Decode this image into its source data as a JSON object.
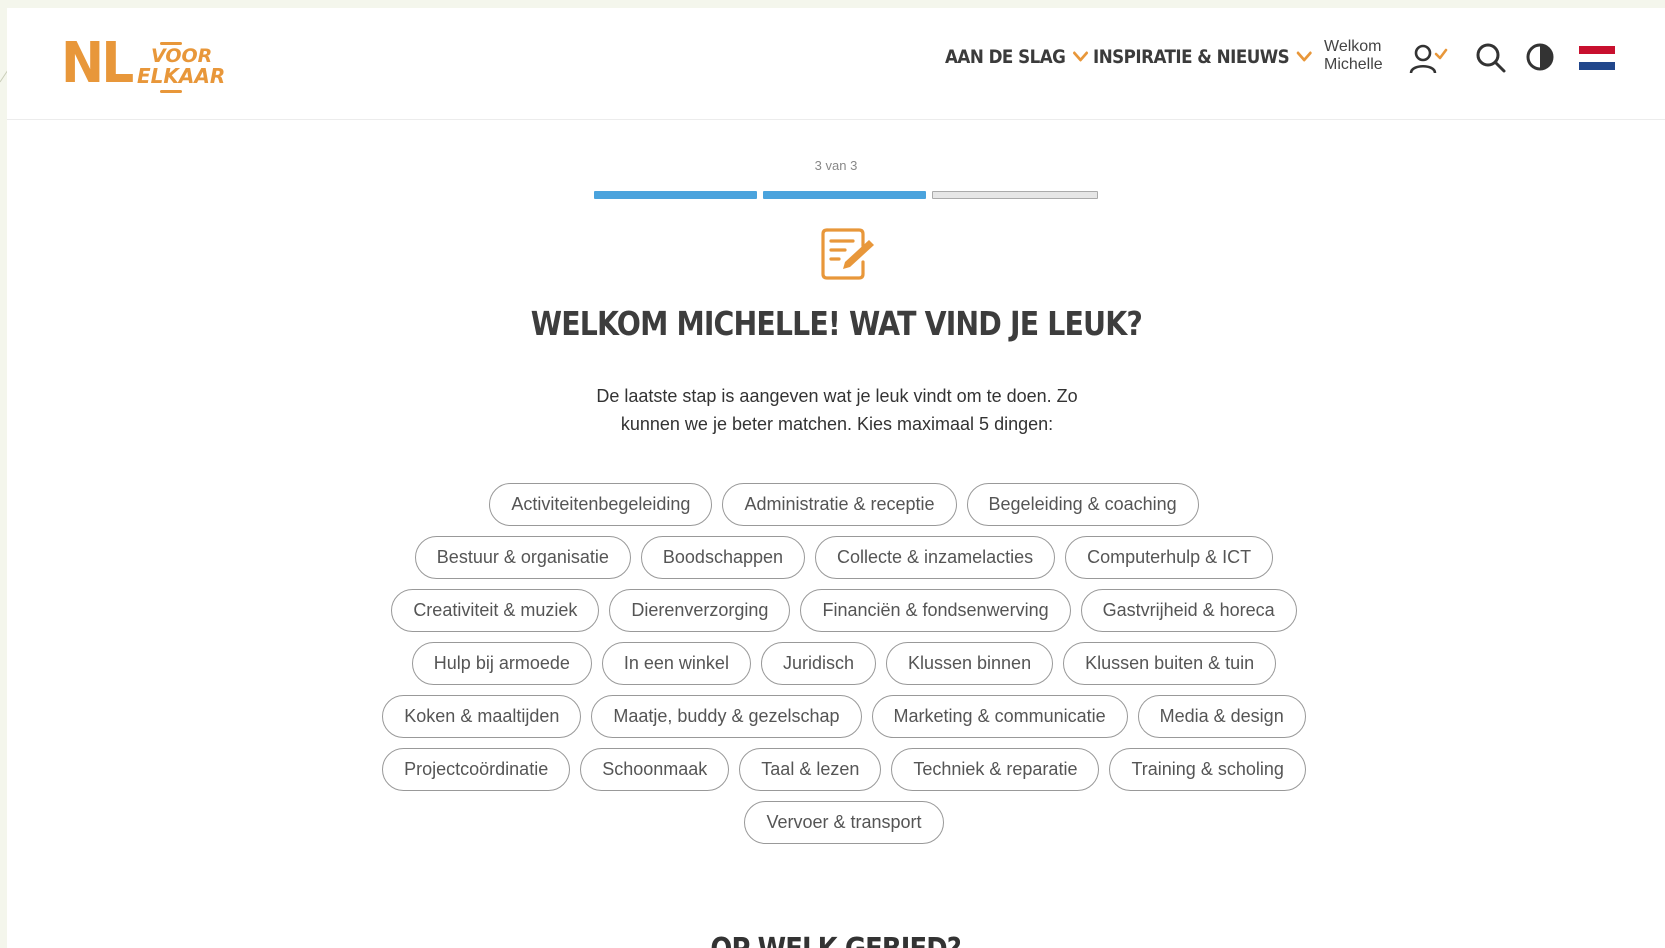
{
  "logo": {
    "nl": "NL",
    "voor": "VOOR",
    "elkaar": "ELKAAR"
  },
  "nav": {
    "items": [
      {
        "label": "AAN DE SLAG"
      },
      {
        "label": "INSPIRATIE & NIEUWS"
      }
    ],
    "welcome_line1": "Welkom",
    "welcome_line2": "Michelle",
    "icons": [
      "account-icon",
      "search-icon",
      "contrast-icon",
      "dutch-flag-icon"
    ]
  },
  "progress": {
    "label": "3 van 3",
    "segments": [
      {
        "state": "done"
      },
      {
        "state": "done"
      },
      {
        "state": "todo"
      }
    ],
    "done_color": "#4aa3dd"
  },
  "accent_color": "#e8973a",
  "main": {
    "title": "WELKOM MICHELLE! WAT VIND JE LEUK?",
    "intro": "De laatste stap is aangeven wat je leuk vindt om te doen. Zo kunnen we je beter matchen. Kies maximaal 5 dingen:",
    "tags": [
      "Activiteitenbegeleiding",
      "Administratie & receptie",
      "Begeleiding & coaching",
      "Bestuur & organisatie",
      "Boodschappen",
      "Collecte & inzamelacties",
      "Computerhulp & ICT",
      "Creativiteit & muziek",
      "Dierenverzorging",
      "Financiën & fondsenwerving",
      "Gastvrijheid & horeca",
      "Hulp bij armoede",
      "In een winkel",
      "Juridisch",
      "Klussen binnen",
      "Klussen buiten & tuin",
      "Koken & maaltijden",
      "Maatje, buddy & gezelschap",
      "Marketing & communicatie",
      "Media & design",
      "Projectcoördinatie",
      "Schoonmaak",
      "Taal & lezen",
      "Techniek & reparatie",
      "Training & scholing",
      "Vervoer & transport"
    ],
    "next_section_title": "OP WELK GEBIED?"
  }
}
